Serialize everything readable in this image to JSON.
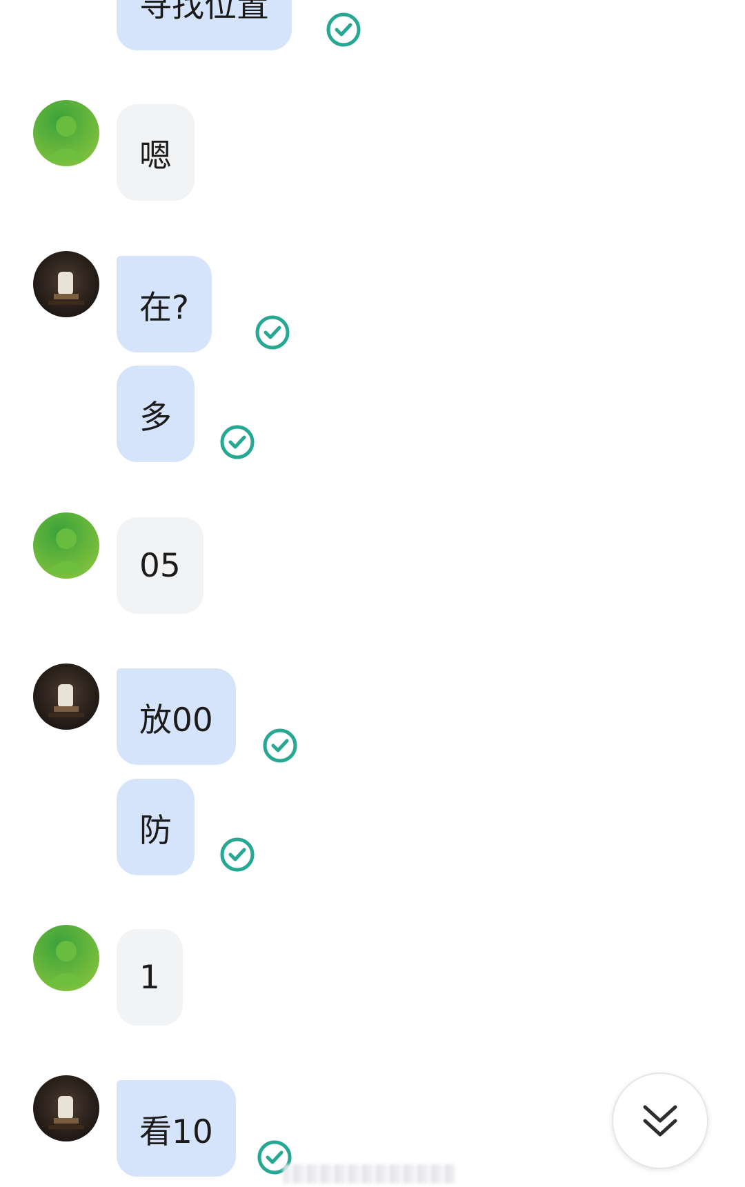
{
  "colors": {
    "sent_bubble": "#d6e4fb",
    "received_bubble": "#f2f3f5",
    "read_check": "#26a893",
    "text": "#1b1b1b"
  },
  "messages": [
    {
      "sender": "me",
      "text": "寻找位置",
      "status": "read-check-icon"
    },
    {
      "sender": "other",
      "text": "嗯"
    },
    {
      "sender": "me",
      "text": "在?",
      "status": "read-check-icon"
    },
    {
      "sender": "me",
      "text": "多",
      "status": "read-check-icon"
    },
    {
      "sender": "other",
      "text": "05"
    },
    {
      "sender": "me",
      "text": "放00",
      "status": "read-check-icon"
    },
    {
      "sender": "me",
      "text": "防",
      "status": "read-check-icon"
    },
    {
      "sender": "other",
      "text": "1"
    },
    {
      "sender": "me",
      "text": "看10",
      "status": "read-check-icon"
    }
  ],
  "scroll_button": {
    "icon": "double-chevron-down-icon"
  }
}
